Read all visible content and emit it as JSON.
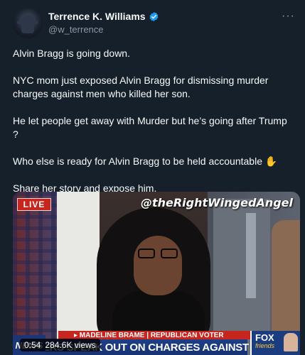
{
  "tweet": {
    "display_name": "Terrence K. Williams",
    "handle": "@w_terrence",
    "more_label": "···",
    "paragraphs": [
      "Alvin Bragg is going down.",
      "NYC mom  just exposed  Alvin Bragg for dismissing murder charges against men who killed her son.",
      "He let people get away with Murder but he’s going after Trump ?",
      "Who else is ready for Alvin Bragg to be held accountable ✋",
      "Share her story and expose him."
    ]
  },
  "media": {
    "live_label": "LIVE",
    "watermark": "@theRightWingedAngel",
    "chyron_subtitle": "▸ MADELINE BRAME | REPUBLICAN VOTER",
    "chyron_headline": "VOTERS SPEAK OUT ON CHARGES AGAINST TRUMP",
    "news_tag": "NEWS",
    "fox_text": "FOX",
    "fox_sub": "friends",
    "duration": "0:54",
    "views": "284.6K views"
  },
  "colors": {
    "background": "#15202b",
    "verified_blue": "#1d9bf0",
    "live_red": "#c7261f",
    "chyron_blue": "#1e3f86"
  }
}
